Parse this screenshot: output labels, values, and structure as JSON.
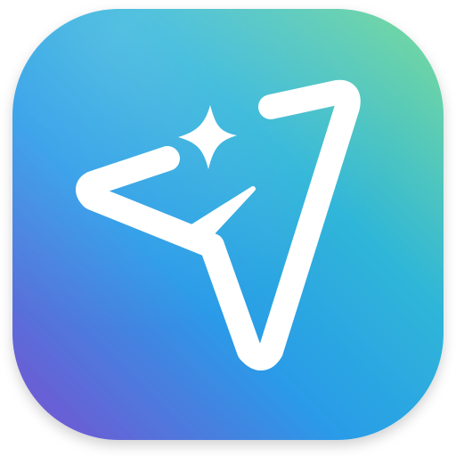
{
  "app_icon": {
    "name": "send-sparkle-app-icon",
    "glyph": "paper-plane-icon",
    "accent": "sparkle-icon",
    "colors": {
      "gradient_top_right": "#7ddc9a",
      "gradient_mid": "#2fb6d8",
      "gradient_center": "#2a9be8",
      "gradient_bottom_left": "#7a4fd0",
      "glyph": "#ffffff"
    }
  }
}
